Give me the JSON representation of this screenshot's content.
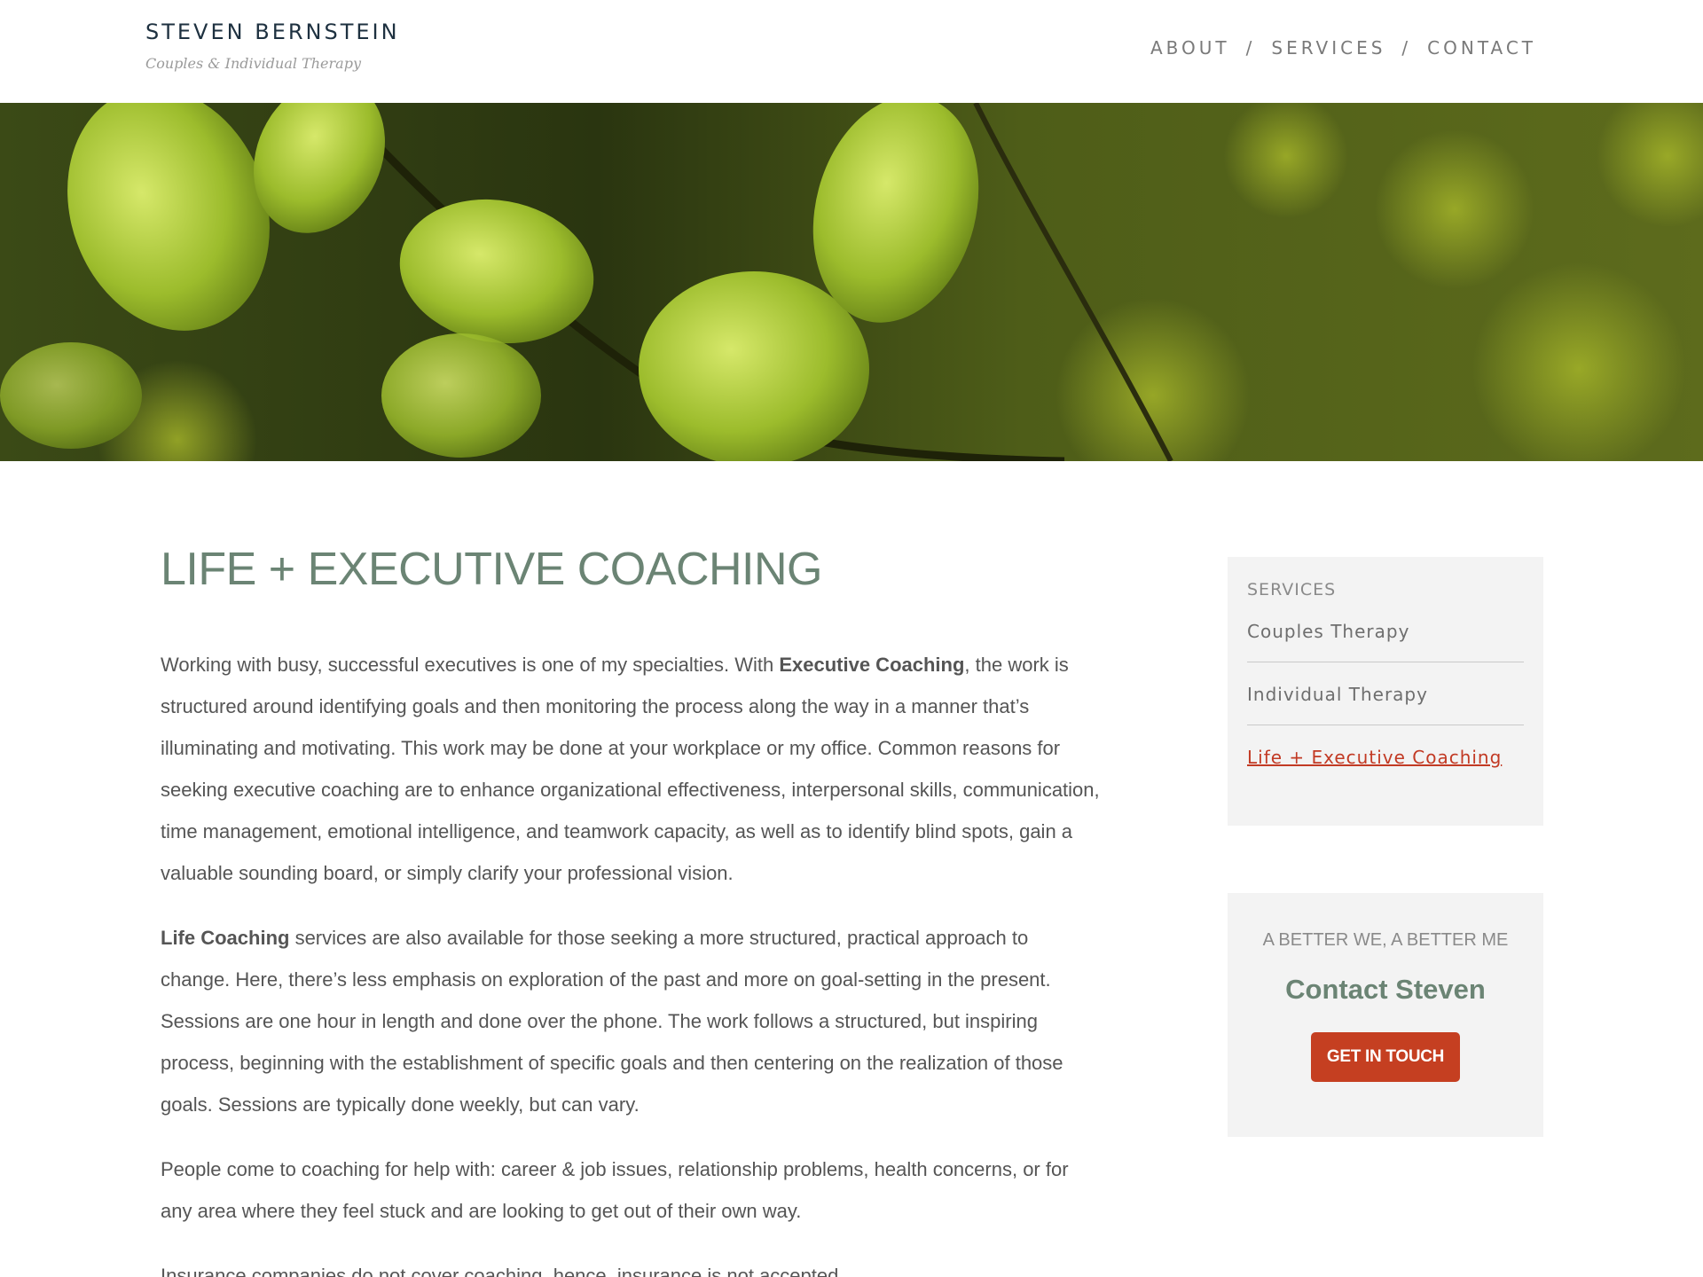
{
  "header": {
    "brand_name": "STEVEN BERNSTEIN",
    "brand_tagline": "Couples & Individual Therapy",
    "nav": [
      {
        "label": "ABOUT"
      },
      {
        "label": "SERVICES"
      },
      {
        "label": "CONTACT"
      }
    ],
    "nav_separator": "/"
  },
  "main": {
    "title": "LIFE + EXECUTIVE COACHING",
    "paragraphs": {
      "p1_intro": "Working with busy, successful executives is one of my specialties. With ",
      "p1_bold": "Executive Coaching",
      "p1_rest": ", the work is structured around identifying goals and then monitoring the process along the way in a manner that’s illuminating and motivating. This work may be done at your workplace or my office. Common reasons for seeking executive coaching are to enhance organizational effectiveness, interpersonal skills, communication, time management, emotional intelligence, and teamwork capacity, as well as to identify blind spots, gain a valuable sounding board, or simply clarify your professional vision.",
      "p2_bold": "Life Coaching",
      "p2_rest": " services are also available for those seeking a more structured, practical approach to change. Here, there’s less emphasis on exploration of the past and more on goal-setting in the present. Sessions are one hour in length and done over the phone. The work follows a structured, but inspiring process, beginning with the establishment of specific goals and then centering on the realization of those goals. Sessions are typically done weekly, but can vary.",
      "p3": "People come to coaching for help with: career & job issues, relationship problems, health concerns, or for any area where they feel stuck and are looking to get out of their own way.",
      "p4": "Insurance companies do not cover coaching, hence, insurance is not accepted."
    }
  },
  "sidebar": {
    "services": {
      "heading": "SERVICES",
      "items": [
        {
          "label": "Couples Therapy",
          "active": false
        },
        {
          "label": "Individual Therapy",
          "active": false
        },
        {
          "label": "Life + Executive Coaching",
          "active": true
        }
      ]
    },
    "contact": {
      "kicker": "A BETTER WE, A BETTER ME",
      "title": "Contact Steven",
      "button_label": "GET IN TOUCH"
    }
  },
  "colors": {
    "accent": "#c53f21",
    "title_green": "#6b8474",
    "brand_navy": "#1e3140",
    "sidebar_bg": "#f3f3f3"
  }
}
